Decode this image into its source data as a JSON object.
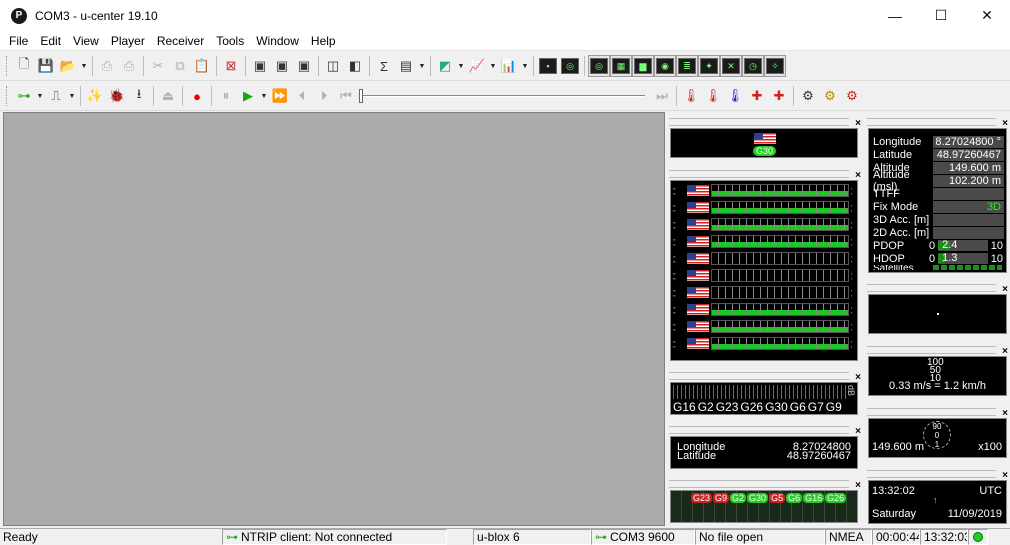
{
  "window": {
    "title": "COM3 - u-center 19.10",
    "logo_letter": "P",
    "minimize": "—",
    "maximize": "☐",
    "close": "✕"
  },
  "menu": [
    {
      "label": "File"
    },
    {
      "label": "Edit"
    },
    {
      "label": "View"
    },
    {
      "label": "Player"
    },
    {
      "label": "Receiver"
    },
    {
      "label": "Tools"
    },
    {
      "label": "Window"
    },
    {
      "label": "Help"
    }
  ],
  "panels": {
    "close_glyph": "×",
    "sat_top": {
      "label": "G30"
    },
    "sat_bar": {
      "labels": [
        "G16",
        "G2",
        "G23",
        "G26",
        "G30",
        "G6",
        "G7",
        "G9"
      ],
      "scale": "dB"
    },
    "pos_small": {
      "longitude_label": "Longitude",
      "longitude": "8.27024800",
      "latitude_label": "Latitude",
      "latitude": "48.97260467"
    },
    "sky_labels": [
      "G23",
      "G9",
      "G2",
      "G30",
      "G5",
      "G6",
      "G16",
      "G26"
    ],
    "navigation": {
      "rows": [
        {
          "label": "Longitude",
          "value": "8.27024800 °"
        },
        {
          "label": "Latitude",
          "value": "48.97260467 °"
        },
        {
          "label": "Altitude",
          "value": "149.600 m"
        },
        {
          "label": "Altitude (msl)",
          "value": "102.200 m"
        },
        {
          "label": "TTFF",
          "value": ""
        },
        {
          "label": "Fix Mode",
          "value": "3D"
        },
        {
          "label": "3D Acc. [m]",
          "value": ""
        },
        {
          "label": "2D Acc. [m]",
          "value": ""
        }
      ],
      "pdop": {
        "label": "PDOP",
        "min": "0",
        "value": "2.4",
        "max": "10",
        "fraction": 0.24
      },
      "hdop": {
        "label": "HDOP",
        "min": "0",
        "value": "1.3",
        "max": "10",
        "fraction": 0.13
      },
      "satellites_label": "Satellites"
    },
    "speed": {
      "scale_top": "100",
      "scale_mid": "50",
      "scale_low": "10",
      "value": "0.33 m/s = 1.2 km/h"
    },
    "altimeter": {
      "value": "149.600 m",
      "scale": "x100",
      "ticks": [
        "90",
        "0",
        "1"
      ]
    },
    "clock": {
      "time": "13:32:02",
      "zone": "UTC",
      "day": "Saturday",
      "date": "11/09/2019"
    }
  },
  "status": {
    "ready": "Ready",
    "ntrip": "NTRIP client: Not connected",
    "receiver": "u-blox 6",
    "port": "COM3 9600",
    "file": "No file open",
    "protocol": "NMEA",
    "elapsed": "00:00:44",
    "time": "13:32:03"
  }
}
